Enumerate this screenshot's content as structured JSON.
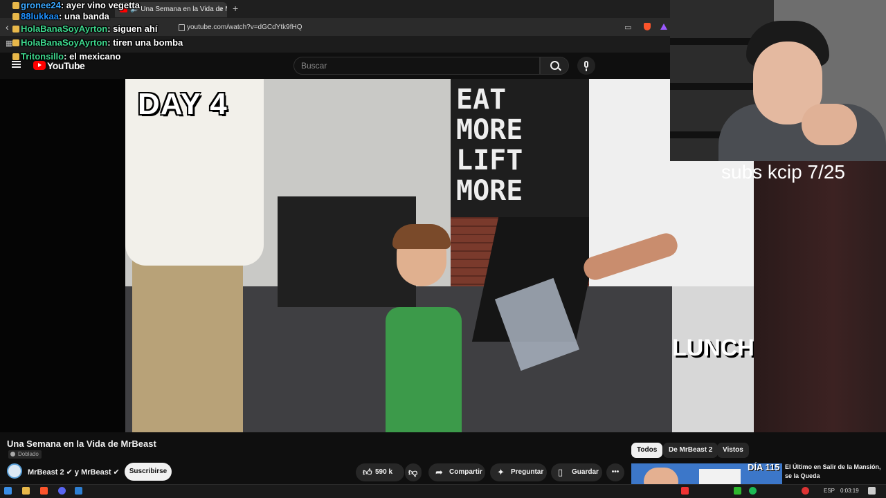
{
  "browser": {
    "tab_label": "🔊 Una Semana en la Vida de M",
    "tab_favicon_text": "YouTube",
    "new_tab": "+",
    "close_tab": "×",
    "url": "youtube.com/watch?v=dGCdYtk9fHQ"
  },
  "youtube": {
    "logo_text": "YouTube",
    "search_placeholder": "Buscar"
  },
  "chat": [
    {
      "user": "gronee24",
      "user_color": "#3aa7ff",
      "text": ": ayer vino vegetta"
    },
    {
      "user": "88lukkaa",
      "user_color": "#1e90ff",
      "text": ": una banda"
    },
    {
      "user": "HolaBanaSoyAyrton",
      "user_color": "#3dd68c",
      "text": ": siguen ahí"
    },
    {
      "user": "HolaBanaSoyAyrton",
      "user_color": "#3dd68c",
      "text": ": tiren una bomba"
    },
    {
      "user": "Tritonsillo",
      "user_color": "#3dd68c",
      "text": ": el mexicano"
    }
  ],
  "video": {
    "overlay_text": "DAY 4",
    "chalkboard_text": "EAT\nMORE\nLIFT\nMORE",
    "cart_text": "LUNCH"
  },
  "stream_overlay": {
    "subs_text": "subs kcip 7/25"
  },
  "details": {
    "title": "Una Semana en la Vida de MrBeast",
    "dubbed_label": "Doblado",
    "channel": "MrBeast 2 ✔ y MrBeast ✔",
    "subscribe_label": "Suscribirse",
    "like_count": "590 k",
    "share_label": "Compartir",
    "ask_label": "Preguntar",
    "save_label": "Guardar",
    "more_label": "•••"
  },
  "recommendations": {
    "chips": [
      "Todos",
      "De MrBeast 2",
      "Vistos"
    ],
    "first_title": "El Último en Salir de la Mansión, se la Queda",
    "first_thumb_text": "DÍA 115"
  },
  "taskbar": {
    "language": "ESP",
    "time": "0:03:19"
  },
  "colors": {
    "youtube_red": "#ff0000",
    "background": "#0f0f0f",
    "chat_green": "#3dd68c",
    "chat_blue": "#3aa7ff"
  }
}
